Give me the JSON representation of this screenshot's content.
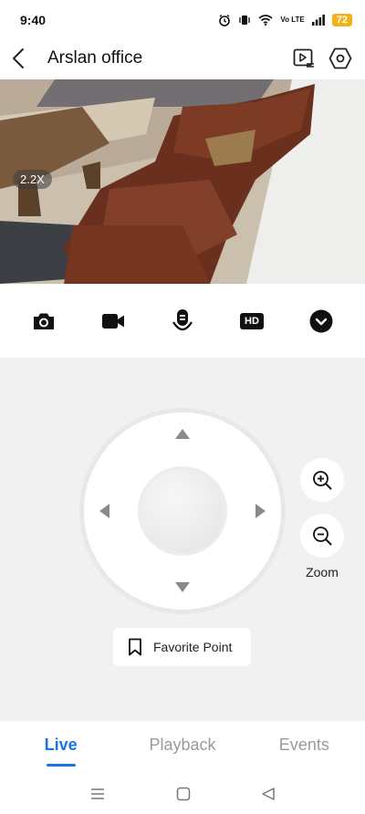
{
  "status_bar": {
    "time": "9:40",
    "network_label": "Vo LTE",
    "battery": "72"
  },
  "header": {
    "title": "Arslan office",
    "icons": [
      "back-icon",
      "playlist-icon",
      "settings-icon"
    ]
  },
  "video": {
    "zoom_level": "2.2X"
  },
  "toolbar": {
    "icons": [
      "camera-icon",
      "record-icon",
      "talk-icon",
      "hd-icon",
      "expand-icon"
    ],
    "hd_label": "HD"
  },
  "ptz": {
    "zoom_label": "Zoom",
    "favorite_label": "Favorite Point"
  },
  "tabs": [
    {
      "label": "Live",
      "active": true
    },
    {
      "label": "Playback",
      "active": false
    },
    {
      "label": "Events",
      "active": false
    }
  ],
  "colors": {
    "accent": "#1a73e8",
    "battery": "#f2b21b",
    "panel": "#f1f1f1"
  }
}
